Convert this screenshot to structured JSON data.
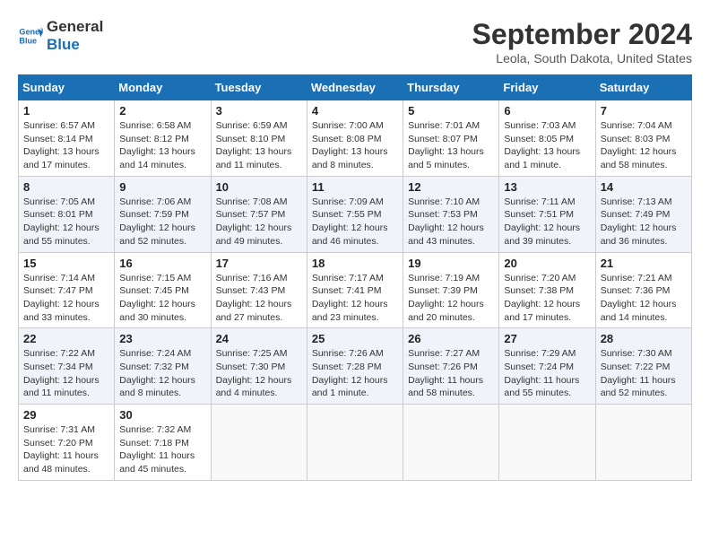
{
  "logo": {
    "line1": "General",
    "line2": "Blue"
  },
  "title": "September 2024",
  "location": "Leola, South Dakota, United States",
  "headers": [
    "Sunday",
    "Monday",
    "Tuesday",
    "Wednesday",
    "Thursday",
    "Friday",
    "Saturday"
  ],
  "weeks": [
    [
      {
        "day": "1",
        "lines": [
          "Sunrise: 6:57 AM",
          "Sunset: 8:14 PM",
          "Daylight: 13 hours",
          "and 17 minutes."
        ]
      },
      {
        "day": "2",
        "lines": [
          "Sunrise: 6:58 AM",
          "Sunset: 8:12 PM",
          "Daylight: 13 hours",
          "and 14 minutes."
        ]
      },
      {
        "day": "3",
        "lines": [
          "Sunrise: 6:59 AM",
          "Sunset: 8:10 PM",
          "Daylight: 13 hours",
          "and 11 minutes."
        ]
      },
      {
        "day": "4",
        "lines": [
          "Sunrise: 7:00 AM",
          "Sunset: 8:08 PM",
          "Daylight: 13 hours",
          "and 8 minutes."
        ]
      },
      {
        "day": "5",
        "lines": [
          "Sunrise: 7:01 AM",
          "Sunset: 8:07 PM",
          "Daylight: 13 hours",
          "and 5 minutes."
        ]
      },
      {
        "day": "6",
        "lines": [
          "Sunrise: 7:03 AM",
          "Sunset: 8:05 PM",
          "Daylight: 13 hours",
          "and 1 minute."
        ]
      },
      {
        "day": "7",
        "lines": [
          "Sunrise: 7:04 AM",
          "Sunset: 8:03 PM",
          "Daylight: 12 hours",
          "and 58 minutes."
        ]
      }
    ],
    [
      {
        "day": "8",
        "lines": [
          "Sunrise: 7:05 AM",
          "Sunset: 8:01 PM",
          "Daylight: 12 hours",
          "and 55 minutes."
        ]
      },
      {
        "day": "9",
        "lines": [
          "Sunrise: 7:06 AM",
          "Sunset: 7:59 PM",
          "Daylight: 12 hours",
          "and 52 minutes."
        ]
      },
      {
        "day": "10",
        "lines": [
          "Sunrise: 7:08 AM",
          "Sunset: 7:57 PM",
          "Daylight: 12 hours",
          "and 49 minutes."
        ]
      },
      {
        "day": "11",
        "lines": [
          "Sunrise: 7:09 AM",
          "Sunset: 7:55 PM",
          "Daylight: 12 hours",
          "and 46 minutes."
        ]
      },
      {
        "day": "12",
        "lines": [
          "Sunrise: 7:10 AM",
          "Sunset: 7:53 PM",
          "Daylight: 12 hours",
          "and 43 minutes."
        ]
      },
      {
        "day": "13",
        "lines": [
          "Sunrise: 7:11 AM",
          "Sunset: 7:51 PM",
          "Daylight: 12 hours",
          "and 39 minutes."
        ]
      },
      {
        "day": "14",
        "lines": [
          "Sunrise: 7:13 AM",
          "Sunset: 7:49 PM",
          "Daylight: 12 hours",
          "and 36 minutes."
        ]
      }
    ],
    [
      {
        "day": "15",
        "lines": [
          "Sunrise: 7:14 AM",
          "Sunset: 7:47 PM",
          "Daylight: 12 hours",
          "and 33 minutes."
        ]
      },
      {
        "day": "16",
        "lines": [
          "Sunrise: 7:15 AM",
          "Sunset: 7:45 PM",
          "Daylight: 12 hours",
          "and 30 minutes."
        ]
      },
      {
        "day": "17",
        "lines": [
          "Sunrise: 7:16 AM",
          "Sunset: 7:43 PM",
          "Daylight: 12 hours",
          "and 27 minutes."
        ]
      },
      {
        "day": "18",
        "lines": [
          "Sunrise: 7:17 AM",
          "Sunset: 7:41 PM",
          "Daylight: 12 hours",
          "and 23 minutes."
        ]
      },
      {
        "day": "19",
        "lines": [
          "Sunrise: 7:19 AM",
          "Sunset: 7:39 PM",
          "Daylight: 12 hours",
          "and 20 minutes."
        ]
      },
      {
        "day": "20",
        "lines": [
          "Sunrise: 7:20 AM",
          "Sunset: 7:38 PM",
          "Daylight: 12 hours",
          "and 17 minutes."
        ]
      },
      {
        "day": "21",
        "lines": [
          "Sunrise: 7:21 AM",
          "Sunset: 7:36 PM",
          "Daylight: 12 hours",
          "and 14 minutes."
        ]
      }
    ],
    [
      {
        "day": "22",
        "lines": [
          "Sunrise: 7:22 AM",
          "Sunset: 7:34 PM",
          "Daylight: 12 hours",
          "and 11 minutes."
        ]
      },
      {
        "day": "23",
        "lines": [
          "Sunrise: 7:24 AM",
          "Sunset: 7:32 PM",
          "Daylight: 12 hours",
          "and 8 minutes."
        ]
      },
      {
        "day": "24",
        "lines": [
          "Sunrise: 7:25 AM",
          "Sunset: 7:30 PM",
          "Daylight: 12 hours",
          "and 4 minutes."
        ]
      },
      {
        "day": "25",
        "lines": [
          "Sunrise: 7:26 AM",
          "Sunset: 7:28 PM",
          "Daylight: 12 hours",
          "and 1 minute."
        ]
      },
      {
        "day": "26",
        "lines": [
          "Sunrise: 7:27 AM",
          "Sunset: 7:26 PM",
          "Daylight: 11 hours",
          "and 58 minutes."
        ]
      },
      {
        "day": "27",
        "lines": [
          "Sunrise: 7:29 AM",
          "Sunset: 7:24 PM",
          "Daylight: 11 hours",
          "and 55 minutes."
        ]
      },
      {
        "day": "28",
        "lines": [
          "Sunrise: 7:30 AM",
          "Sunset: 7:22 PM",
          "Daylight: 11 hours",
          "and 52 minutes."
        ]
      }
    ],
    [
      {
        "day": "29",
        "lines": [
          "Sunrise: 7:31 AM",
          "Sunset: 7:20 PM",
          "Daylight: 11 hours",
          "and 48 minutes."
        ]
      },
      {
        "day": "30",
        "lines": [
          "Sunrise: 7:32 AM",
          "Sunset: 7:18 PM",
          "Daylight: 11 hours",
          "and 45 minutes."
        ]
      },
      null,
      null,
      null,
      null,
      null
    ]
  ]
}
